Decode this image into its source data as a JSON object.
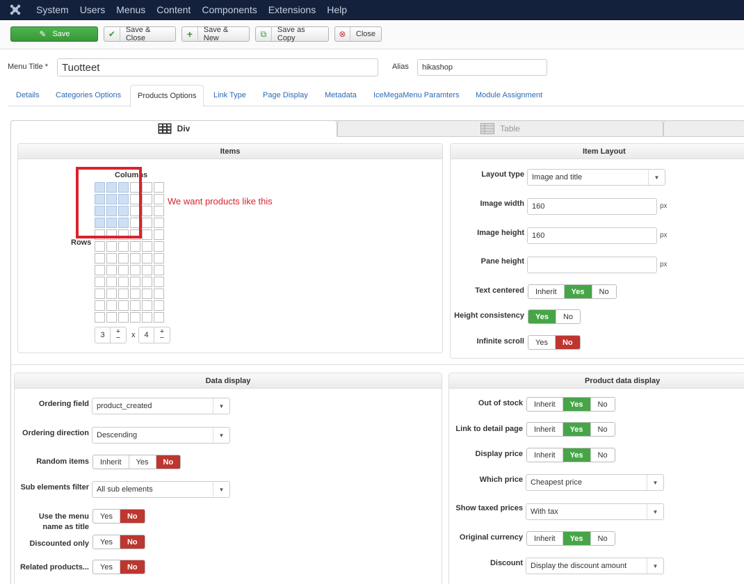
{
  "navbar": {
    "logo_icon": "joomla-logo-icon",
    "items": [
      "System",
      "Users",
      "Menus",
      "Content",
      "Components",
      "Extensions",
      "Help"
    ]
  },
  "toolbar": {
    "save": "Save",
    "save_close": "Save & Close",
    "save_new": "Save & New",
    "save_copy": "Save as Copy",
    "close": "Close"
  },
  "form": {
    "menu_title_label": "Menu Title *",
    "menu_title_value": "Tuotteet",
    "alias_label": "Alias",
    "alias_value": "hikashop"
  },
  "tabs": [
    "Details",
    "Categories Options",
    "Products Options",
    "Link Type",
    "Page Display",
    "Metadata",
    "IceMegaMenu Paramters",
    "Module Assignment"
  ],
  "layout_tabs": {
    "div": "Div",
    "table": "Table"
  },
  "items_panel": {
    "title": "Items",
    "columns_label": "Columns",
    "rows_label": "Rows",
    "columns_value": "3",
    "times": "x",
    "rows_value": "4",
    "annotation": "We want products like this",
    "selected_cols": 3,
    "selected_rows": 4,
    "grid_cols": 6,
    "grid_rows": 12
  },
  "item_layout": {
    "title": "Item Layout",
    "layout_type_label": "Layout type",
    "layout_type_value": "Image and title",
    "image_width_label": "Image width",
    "image_width_value": "160",
    "image_height_label": "Image height",
    "image_height_value": "160",
    "pane_height_label": "Pane height",
    "pane_height_value": "",
    "unit": "px",
    "text_centered_label": "Text centered",
    "height_consistency_label": "Height consistency",
    "infinite_scroll_label": "Infinite scroll"
  },
  "data_display": {
    "title": "Data display",
    "ordering_field_label": "Ordering field",
    "ordering_field_value": "product_created",
    "ordering_direction_label": "Ordering direction",
    "ordering_direction_value": "Descending",
    "random_items_label": "Random items",
    "sub_elements_label": "Sub elements filter",
    "sub_elements_value": "All sub elements",
    "menu_name_label_1": "Use the menu",
    "menu_name_label_2": "name as title",
    "discounted_label": "Discounted only",
    "related_label": "Related products..."
  },
  "product_data": {
    "title": "Product data display",
    "out_of_stock_label": "Out of stock",
    "link_detail_label": "Link to detail page",
    "display_price_label": "Display price",
    "which_price_label": "Which price",
    "which_price_value": "Cheapest price",
    "taxed_label": "Show taxed prices",
    "taxed_value": "With tax",
    "orig_currency_label": "Original currency",
    "discount_label": "Discount",
    "discount_value": "Display the discount amount"
  },
  "options": {
    "inherit": "Inherit",
    "yes": "Yes",
    "no": "No"
  },
  "colors": {
    "navbar": "#14213d",
    "save_green": "#46a546",
    "no_red": "#bd362f",
    "link_blue": "#2a69b8",
    "annotation_red": "#d9232d"
  }
}
